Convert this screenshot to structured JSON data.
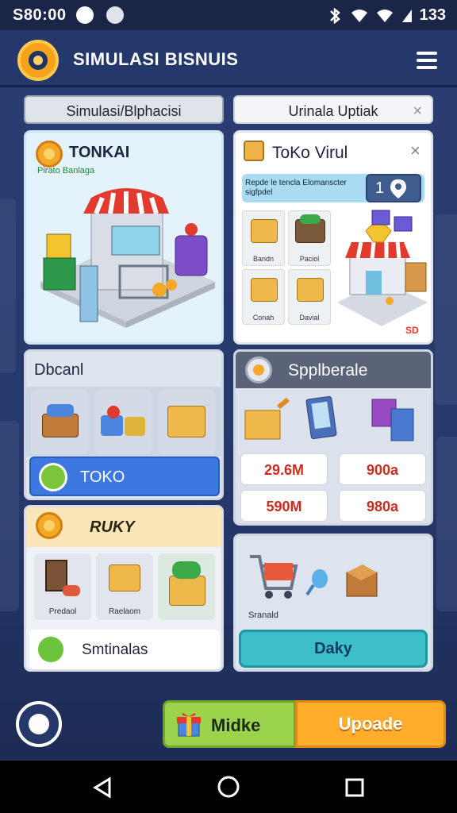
{
  "status": {
    "time": "S80:00",
    "battery": "133"
  },
  "app": {
    "title": "SIMULASI BISNUIS"
  },
  "tabs": [
    {
      "label": "Simulasi/Blphacisi"
    },
    {
      "label": "Urinala Uptiak",
      "close": "×"
    }
  ],
  "toko_card": {
    "title": "TONKAI",
    "subtitle": "Pirato Banlaga"
  },
  "virtual_card": {
    "title": "ToKo Virul",
    "close": "×",
    "banner": "Repde le tencla Elomanscter sigfpdel",
    "count": "1",
    "items": [
      "Bandn",
      "Paciol",
      "Conah",
      "Davial"
    ],
    "tag": "SD"
  },
  "dokumen_card": {
    "title": "Dbcanl",
    "button": "TOKO"
  },
  "supplier_card": {
    "title": "Spplberale",
    "prices": [
      "29.6M",
      "900a",
      "590M",
      "980a"
    ]
  },
  "ruky_card": {
    "title": "RUKY",
    "items": [
      "Predaol",
      "Raelaom"
    ],
    "row_label": "Smtinalas"
  },
  "shop_card": {
    "label": "Sranald",
    "button": "Daky"
  },
  "bottom": {
    "make": "Midke",
    "upgrade": "Upoade"
  },
  "colors": {
    "bg": "#1f2d55",
    "accent_blue": "#3d78e0",
    "accent_green": "#9bd34c",
    "accent_orange": "#ffad2a",
    "price_red": "#cc2d1e"
  }
}
